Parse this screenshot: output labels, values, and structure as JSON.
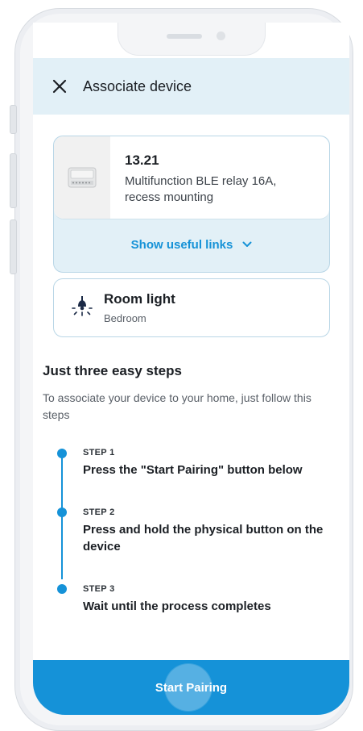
{
  "header": {
    "title": "Associate device",
    "close_icon": "close-icon"
  },
  "device": {
    "code": "13.21",
    "description": "Multifunction BLE relay 16A, recess mounting",
    "links_label": "Show useful links",
    "links_icon": "chevron-down-icon"
  },
  "room": {
    "name": "Room light",
    "location": "Bedroom",
    "icon": "light-bulb-icon"
  },
  "steps": {
    "title": "Just three easy steps",
    "intro": "To associate your device to your home, just follow this steps",
    "items": [
      {
        "label": "STEP 1",
        "text": "Press the \"Start Pairing\" button below"
      },
      {
        "label": "STEP 2",
        "text": "Press and hold the physical button on the device"
      },
      {
        "label": "STEP 3",
        "text": "Wait until the process completes"
      }
    ]
  },
  "footer": {
    "button_label": "Start Pairing"
  },
  "colors": {
    "accent": "#1592d8",
    "header_bg": "#e2f0f7",
    "card_border": "#b9d6e6"
  }
}
